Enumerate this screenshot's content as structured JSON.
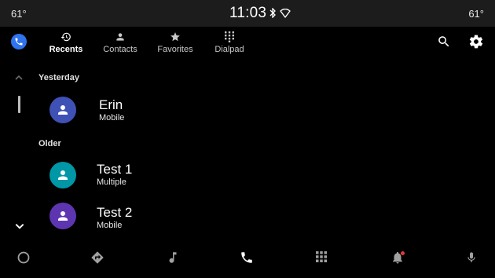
{
  "status_bar": {
    "temp_left": "61°",
    "time": "11:03",
    "temp_right": "61°"
  },
  "app": {
    "icon": "phone-icon",
    "accent_color": "#2f73ee"
  },
  "tabs": [
    {
      "label": "Recents",
      "icon": "history-icon",
      "active": true
    },
    {
      "label": "Contacts",
      "icon": "person-icon",
      "active": false
    },
    {
      "label": "Favorites",
      "icon": "star-icon",
      "active": false
    },
    {
      "label": "Dialpad",
      "icon": "dialpad-icon",
      "active": false
    }
  ],
  "sections": [
    {
      "header": "Yesterday",
      "items": [
        {
          "name": "Erin",
          "type": "Mobile",
          "avatar_color": "#3f51b5"
        }
      ]
    },
    {
      "header": "Older",
      "items": [
        {
          "name": "Test 1",
          "type": "Multiple",
          "avatar_color": "#0097a7"
        },
        {
          "name": "Test 2",
          "type": "Mobile",
          "avatar_color": "#5e35b1"
        }
      ]
    }
  ],
  "bottom_nav": {
    "items": [
      "home-icon",
      "navigation-icon",
      "music-icon",
      "phone-icon",
      "apps-icon",
      "notifications-icon",
      "microphone-icon"
    ],
    "active": "phone-icon",
    "notification_badge_color": "#e53935"
  }
}
